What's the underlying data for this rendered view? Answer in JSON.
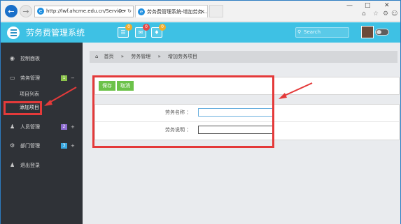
{
  "browser": {
    "address": "http://lwf.ahcme.edu.cn/Service",
    "tab_title": "劳务费管理系统-增加劳务..."
  },
  "header": {
    "brand": "劳务费管理系统",
    "badges": [
      "0",
      "0",
      "0"
    ],
    "search_placeholder": "Search"
  },
  "sidebar": {
    "items": [
      {
        "label": "控制面板"
      },
      {
        "label": "劳务管理",
        "badge": "1",
        "toggle": "−"
      },
      {
        "label": "人员管理",
        "badge": "2",
        "toggle": "+"
      },
      {
        "label": "部门管理",
        "badge": "3",
        "toggle": "+"
      },
      {
        "label": "退出登录"
      }
    ],
    "subitems": [
      {
        "label": "项目列表"
      },
      {
        "label": "添加项目"
      }
    ]
  },
  "breadcrumb": {
    "home": "首页",
    "level1": "劳务管理",
    "level2": "增加劳务项目",
    "sep": "»"
  },
  "toolbar": {
    "save": "保存",
    "cancel": "取消"
  },
  "form": {
    "name_label": "劳务名称 ：",
    "desc_label": "劳务说明 ：",
    "name_value": "",
    "desc_value": ""
  },
  "colors": {
    "header": "#3ec1e4",
    "sidebar": "#2f3237",
    "button": "#6cc24a",
    "highlight": "#e43a3a"
  }
}
